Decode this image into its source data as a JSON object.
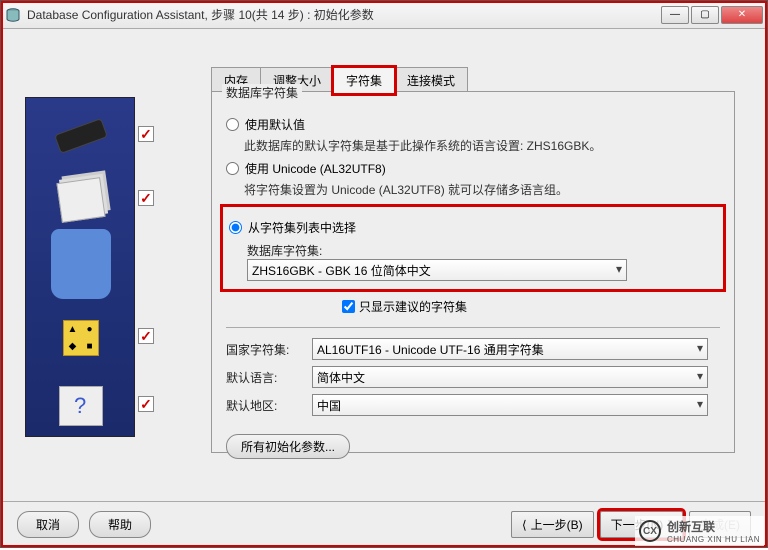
{
  "titlebar": {
    "text": "Database Configuration Assistant, 步骤 10(共 14 步) : 初始化参数"
  },
  "win_buttons": {
    "min": "—",
    "max": "▢",
    "close": "✕"
  },
  "tabs": {
    "memory": "内存",
    "sizing": "调整大小",
    "charset": "字符集",
    "connection": "连接模式"
  },
  "groupbox": {
    "title": "数据库字符集",
    "use_default": "使用默认值",
    "use_default_desc": "此数据库的默认字符集是基于此操作系统的语言设置: ZHS16GBK。",
    "use_unicode": "使用 Unicode (AL32UTF8)",
    "use_unicode_desc": "将字符集设置为 Unicode (AL32UTF8) 就可以存储多语言组。",
    "from_list": "从字符集列表中选择",
    "db_charset_label": "数据库字符集:",
    "db_charset_value": "ZHS16GBK - GBK 16 位简体中文",
    "show_recommended": "只显示建议的字符集",
    "national_label": "国家字符集:",
    "national_value": "AL16UTF16 - Unicode UTF-16 通用字符集",
    "default_lang_label": "默认语言:",
    "default_lang_value": "简体中文",
    "default_locale_label": "默认地区:",
    "default_locale_value": "中国",
    "all_params": "所有初始化参数..."
  },
  "bottom": {
    "cancel": "取消",
    "help": "帮助",
    "back": "上一步(B)",
    "next": "下一步(N)",
    "finish": "完成(E)"
  },
  "watermark": {
    "brand": "创新互联",
    "sub": "CHUANG XIN HU LIAN",
    "logo": "CX"
  }
}
